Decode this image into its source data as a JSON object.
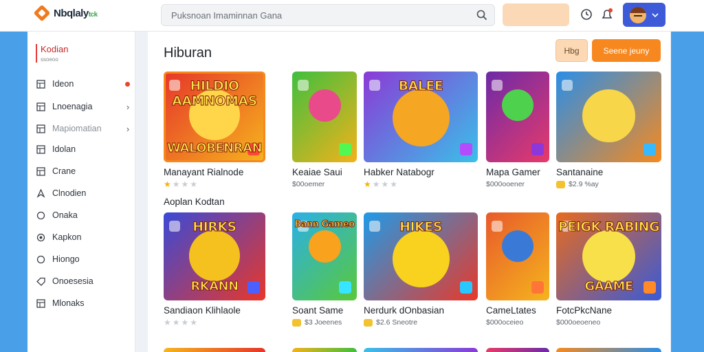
{
  "header": {
    "logo_text": "Nbqlaly",
    "logo_sub": "tck",
    "search_placeholder": "Puksnoan Imaminnan Gana"
  },
  "sidebar": {
    "title": "Kodian",
    "subtitle": "ssoeoo",
    "items": [
      {
        "label": "Ideon",
        "icon": "grid-icon",
        "marker": "dot"
      },
      {
        "label": "Lnoenagia",
        "icon": "grid-icon",
        "marker": "chevron"
      },
      {
        "label": "Mapiomatian",
        "icon": "grid-icon",
        "marker": "chevron",
        "muted": true
      },
      {
        "label": "Idolan",
        "icon": "grid-icon"
      },
      {
        "label": "Crane",
        "icon": "grid-icon"
      },
      {
        "label": "Clnodien",
        "icon": "pin-icon"
      },
      {
        "label": "Onaka",
        "icon": "circle-icon"
      },
      {
        "label": "Kapkon",
        "icon": "target-icon"
      },
      {
        "label": "Hiongo",
        "icon": "circle-icon"
      },
      {
        "label": "Onoesesia",
        "icon": "tag-icon"
      },
      {
        "label": "Mlonaks",
        "icon": "grid-icon"
      }
    ]
  },
  "main": {
    "title": "Hiburan",
    "btn_light_label": "Hbg",
    "btn_primary_label": "Seene jeuny",
    "section_label": "Aoplan Kodtan",
    "row1": [
      {
        "title": "Manayant Rialnode",
        "meta": "",
        "rating": 1,
        "thumb_text": "HILDIO AAMNOMAS",
        "thumb_text2": "WALOBENRAN"
      },
      {
        "title": "Keaiae Saui",
        "meta": "$00oemer",
        "rating": 0,
        "thumb_text": "",
        "thumb_text2": ""
      },
      {
        "title": "Habker Natabogr",
        "meta": "",
        "rating": 1,
        "thumb_text": "BALEE",
        "thumb_text2": ""
      },
      {
        "title": "Mapa Gamer",
        "meta": "$000ooener",
        "rating": 0,
        "thumb_text": "",
        "thumb_text2": ""
      },
      {
        "title": "Santanaine",
        "meta": "$2.9 %ay",
        "rating": 0,
        "thumb_text": "",
        "thumb_text2": ""
      }
    ],
    "row2": [
      {
        "title": "Sandiaon Klihlaole",
        "meta": "",
        "rating": 0,
        "thumb_text": "HIRKS",
        "thumb_text2": "RKANN"
      },
      {
        "title": "Soant Same",
        "meta": "$3 Joeenes",
        "rating": 0,
        "thumb_text": "Bann Gameo",
        "thumb_text2": ""
      },
      {
        "title": "Nerdurk dOnbasian",
        "meta": "$2.6 Sneotre",
        "rating": 0,
        "thumb_text": "HIKES",
        "thumb_text2": ""
      },
      {
        "title": "CameLtates",
        "meta": "$000oceieo",
        "rating": 0,
        "thumb_text": "",
        "thumb_text2": ""
      },
      {
        "title": "FotcPkcNane",
        "meta": "$000oeoeneo",
        "rating": 0,
        "thumb_text": "PEIGK RABING",
        "thumb_text2": "GAAME"
      }
    ]
  },
  "colors": {
    "accent": "#f7881f",
    "accent_light": "#fcd9b4",
    "avatar_bg": "#3d5bd8",
    "stripe": "#4aa0e8",
    "star": "#f5b400",
    "nav_dot": "#e8452c"
  }
}
